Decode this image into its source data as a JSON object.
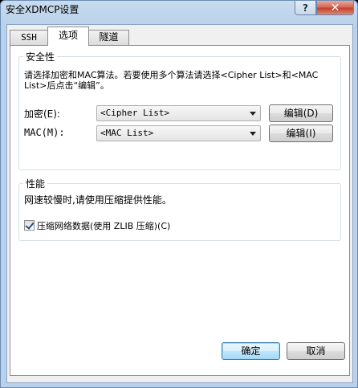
{
  "window": {
    "title": "安全XDMCP设置",
    "help_glyph": "?",
    "close_glyph": "✕"
  },
  "tabs": [
    {
      "label": "SSH",
      "active": false
    },
    {
      "label": "选项",
      "active": true
    },
    {
      "label": "隧道",
      "active": false
    }
  ],
  "security": {
    "group_label": "安全性",
    "desc_line1": "请选择加密和MAC算法。若要使用多个算法请选择<Cipher List>和<MAC",
    "desc_line2": "List>后点击“编辑”。",
    "cipher_label": "加密(E):",
    "cipher_value": "<Cipher List>",
    "cipher_edit": "编辑(D)",
    "mac_label": "MAC(M):",
    "mac_value": "<MAC List>",
    "mac_edit": "编辑(I)"
  },
  "performance": {
    "group_label": "性能",
    "desc": "网速较慢时,请使用压缩提供性能。",
    "compress_label": "压缩网络数据(使用 ZLIB 压缩)(C)",
    "compress_checked": true
  },
  "footer": {
    "ok_label": "确定",
    "cancel_label": "取消"
  },
  "icons": [
    "help-icon",
    "close-icon",
    "dropdown-arrow-icon",
    "checkmark-icon"
  ]
}
